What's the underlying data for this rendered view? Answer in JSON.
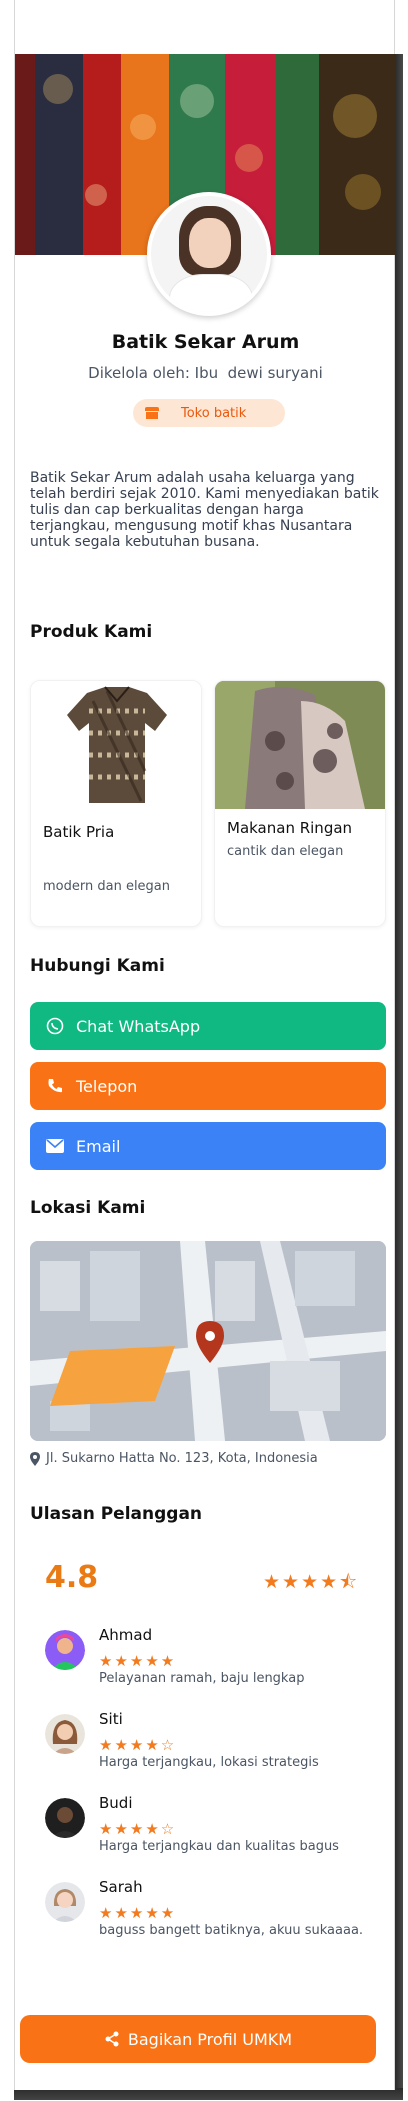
{
  "profile": {
    "shop_name": "Batik Sekar Arum",
    "manager": "Dikelola oleh: Ibu  dewi suryani",
    "category": "Toko batik",
    "description": "Batik Sekar Arum adalah usaha keluarga yang telah berdiri sejak 2010. Kami menyediakan batik tulis dan cap berkualitas dengan harga terjangkau, mengusung motif khas Nusantara untuk segala kebutuhan busana."
  },
  "products": {
    "title": "Produk Kami",
    "items": [
      {
        "name": "Batik Pria",
        "subtitle": "modern dan elegan"
      },
      {
        "name": "Makanan Ringan",
        "subtitle": "cantik dan elegan"
      }
    ]
  },
  "contact": {
    "title": "Hubungi Kami",
    "whatsapp_label": "Chat WhatsApp",
    "phone_label": "Telepon",
    "email_label": "Email",
    "colors": {
      "whatsapp": "#10b981",
      "phone": "#f97316",
      "email": "#3b82f6"
    }
  },
  "location": {
    "title": "Lokasi Kami",
    "address": "Jl. Sukarno Hatta No. 123, Kota, Indonesia"
  },
  "reviews": {
    "title": "Ulasan Pelanggan",
    "average": "4.8",
    "average_stars": "★★★★⯪",
    "items": [
      {
        "name": "Ahmad",
        "stars": "★★★★★",
        "text": "Pelayanan ramah, baju lengkap"
      },
      {
        "name": "Siti",
        "stars": "★★★★☆",
        "text": "Harga terjangkau, lokasi strategis"
      },
      {
        "name": "Budi",
        "stars": "★★★★☆",
        "text": "Harga terjangkau dan kualitas bagus"
      },
      {
        "name": "Sarah",
        "stars": "★★★★★",
        "text": "baguss bangett batiknya, akuu sukaaaa."
      }
    ]
  },
  "share": {
    "label": "Bagikan Profil UMKM"
  },
  "accent_color": "#f97316"
}
